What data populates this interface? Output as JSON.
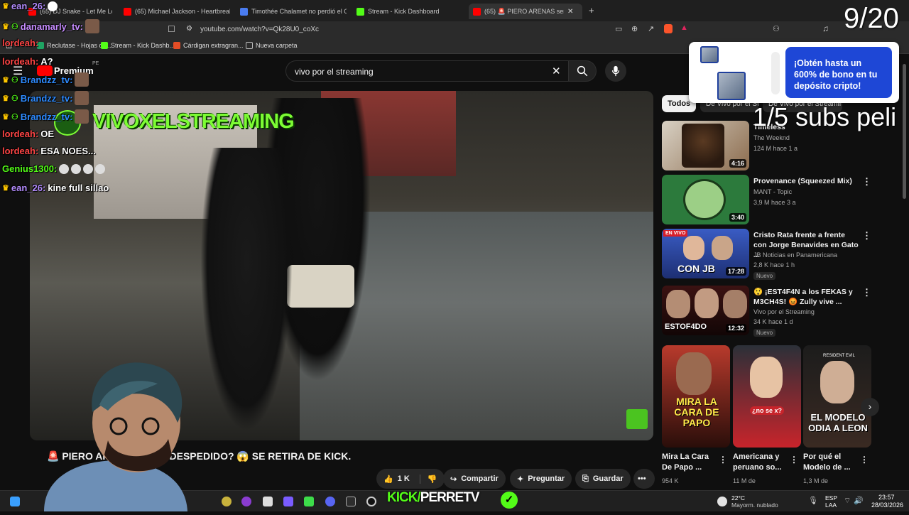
{
  "browser": {
    "tabs": [
      {
        "label": "(65) DJ Snake - Let Me Love You ft. J...",
        "color": "#ff0000"
      },
      {
        "label": "(65) Michael Jackson - Heartbreak H...",
        "color": "#ff0000"
      },
      {
        "label": "Timothée Chalamet no perdió el Osc...",
        "color": "#4a7cf0"
      },
      {
        "label": "Stream - Kick Dashboard",
        "color": "#53fc18"
      },
      {
        "label": "(65) 🚨 PIERO ARENAS será ¿DE...",
        "color": "#ff0000"
      }
    ],
    "new_tab": "+",
    "url": "youtube.com/watch?v=Qk28U0_coXc",
    "bookmarks": [
      {
        "label": "Reclutase - Hojas de...",
        "color": "#1fa463"
      },
      {
        "label": "Stream - Kick Dashb...",
        "color": "#53fc18"
      },
      {
        "label": "Cárdigan extragran...",
        "color": "#e44d26"
      },
      {
        "label": "Nueva carpeta",
        "color": "#bbbbbb"
      }
    ]
  },
  "youtube": {
    "logo_text": "Premium",
    "logo_badge": "PE",
    "search": {
      "value": "vivo por el streaming"
    },
    "video_title": "🚨 PIERO ARENAS será ¿DESPEDIDO? 😱 SE RETIRA DE KICK.",
    "overlay_title": "VIVOXELSTREAMING",
    "actions": {
      "like": "1 K",
      "share": "Compartir",
      "ask": "Preguntar",
      "save": "Guardar",
      "more": "•••"
    },
    "chips": {
      "all": "Todos",
      "second": "De Vivo por el Streaming",
      "third": "De Vivo por el Streaming"
    },
    "recommendations": [
      {
        "title": "Timeless",
        "channel": "The Weeknd",
        "meta": "124 M hace 1 a",
        "duration": "4:16",
        "badge": ""
      },
      {
        "title": "Provenance (Squeezed Mix)",
        "channel": "MANT - Topic",
        "meta": "3,9 M hace 3 a",
        "duration": "3:40",
        "badge": ""
      },
      {
        "title": "Cristo Rata frente a frente con Jorge Benavides en Gato ...",
        "channel": "JB Noticias en Panamericana",
        "meta": "2,8 K hace 1 h",
        "duration": "17:28",
        "badge": "Nuevo"
      },
      {
        "title": "😲 ¡EST4F4N a los FEKAS y M3CH4S! 😡 Zully vive ...",
        "channel": "Vivo por el Streaming",
        "meta": "34 K hace 1 d",
        "duration": "12:32",
        "badge": "Nuevo"
      }
    ],
    "thumb_text": {
      "rec3": "CON JB",
      "rec4": "ESTOF4DO"
    },
    "shorts": [
      {
        "title": "Mira La Cara De Papo ...",
        "views": "954 K",
        "overlay": "MIRA LA CARA DE PAPO"
      },
      {
        "title": "Americana y peruano so...",
        "views": "11 M de",
        "overlay": "¿no se x?"
      },
      {
        "title": "Por qué el Modelo de ...",
        "views": "1,3 M de",
        "overlay": "EL MODELO ODIA A LEON"
      }
    ]
  },
  "stream": {
    "counter": "9/20",
    "subs_goal": "1/5 subs peli",
    "promo": "¡Obtén hasta un 600% de bono en tu depósito cripto!",
    "brand_kick": "KICK/",
    "brand_name": "PERRETV",
    "chat": [
      {
        "name": "ean_26:",
        "msg": "",
        "color": "#b48cff",
        "crown": true
      },
      {
        "name": "danamarly_tv:",
        "msg": "",
        "color": "#c68cff",
        "crown": true
      },
      {
        "name": "lordeah:",
        "msg": "",
        "color": "#ff4545",
        "crown": false
      },
      {
        "name": "lordeah:",
        "msg": "A?",
        "color": "#ff4545",
        "crown": false
      },
      {
        "name": "Brandzz_tv:",
        "msg": "",
        "color": "#2e8bff",
        "crown": true
      },
      {
        "name": "Brandzz_tv:",
        "msg": "",
        "color": "#2e8bff",
        "crown": true
      },
      {
        "name": "Brandzz_tv:",
        "msg": "",
        "color": "#2e8bff",
        "crown": true
      },
      {
        "name": "lordeah:",
        "msg": "OE",
        "color": "#ff4545",
        "crown": false
      },
      {
        "name": "lordeah:",
        "msg": "ESA NOES...",
        "color": "#ff4545",
        "crown": false
      },
      {
        "name": "Genius1300:",
        "msg": "",
        "color": "#53fc18",
        "crown": false
      },
      {
        "name": "ean_26:",
        "msg": "kine full sillao",
        "color": "#b48cff",
        "crown": true
      }
    ]
  },
  "taskbar": {
    "weather_temp": "22°C",
    "weather_desc": "Mayorm. nublado",
    "lang1": "ESP",
    "lang2": "LAA",
    "time": "23:57",
    "date": "28/03/2026"
  },
  "colors": {
    "accent": "#53fc18",
    "promo_blue": "#1e47d6",
    "yt_red": "#ff0000"
  }
}
